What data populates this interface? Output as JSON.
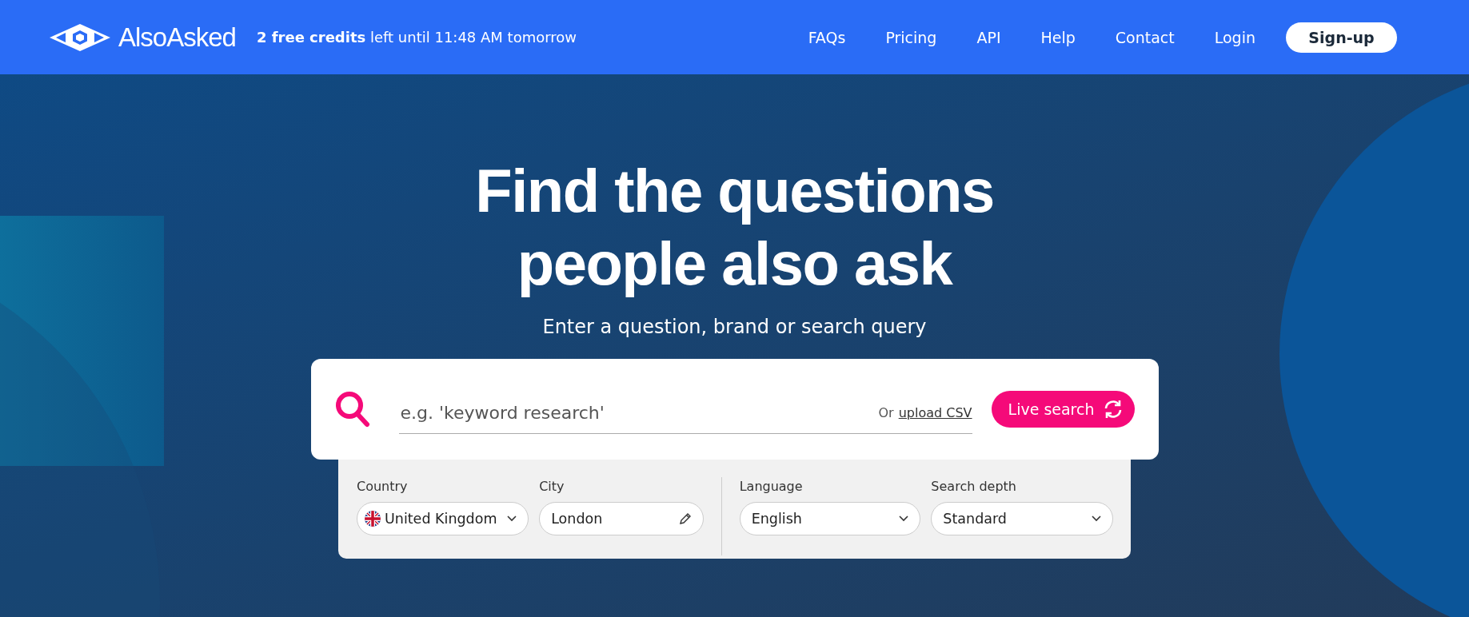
{
  "header": {
    "logo": "AlsoAsked",
    "credits": "**2 free credits** left until 11:48 AM tomorrow",
    "nav": [
      "FAQs",
      "Pricing",
      "API",
      "Help",
      "Contact",
      "Login"
    ],
    "signup": "Sign-up"
  },
  "hero": {
    "title_lines": [
      "Find the questions",
      "people also ask"
    ],
    "subtitle": "Enter a question, brand or search query"
  },
  "search": {
    "placeholder": "e.g. 'keyword research'",
    "or_text": "Or",
    "upload_link": "upload CSV",
    "button": "Live search"
  },
  "options": [
    {
      "kind": "country",
      "label": "Country",
      "value": "United Kingdom"
    },
    {
      "kind": "text",
      "label": "City",
      "value": "London"
    },
    {
      "kind": "select",
      "label": "Language",
      "value": "English"
    },
    {
      "kind": "select",
      "label": "Search depth",
      "value": "Standard"
    }
  ]
}
